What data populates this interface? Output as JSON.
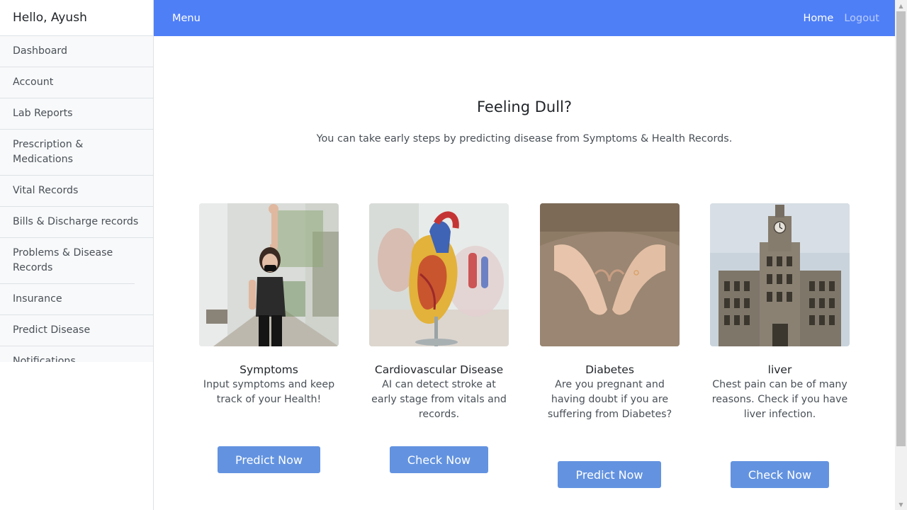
{
  "sidebar": {
    "greeting": "Hello, Ayush",
    "items": [
      {
        "label": "Dashboard"
      },
      {
        "label": "Account"
      },
      {
        "label": "Lab Reports"
      },
      {
        "label": "Prescription & Medications"
      },
      {
        "label": "Vital Records"
      },
      {
        "label": "Bills & Discharge records"
      },
      {
        "label": "Problems & Disease Records"
      },
      {
        "label": "Insurance"
      },
      {
        "label": "Predict Disease"
      },
      {
        "label": "Notifications"
      }
    ]
  },
  "navbar": {
    "menu_label": "Menu",
    "home_label": "Home",
    "logout_label": "Logout",
    "color": "#4f7ff7"
  },
  "hero": {
    "title": "Feeling Dull?",
    "subtitle": "You can take early steps by predicting disease from Symptoms & Health Records."
  },
  "cards": [
    {
      "title": "Symptoms",
      "text": "Input symptoms and keep track of your Health!",
      "button": "Predict Now",
      "image": "woman-raising-fist-photo"
    },
    {
      "title": "Cardiovascular Disease",
      "text": "AI can detect stroke at early stage from vitals and records.",
      "button": "Check Now",
      "image": "heart-model-photo"
    },
    {
      "title": "Diabetes",
      "text": "Are you pregnant and having doubt if you are suffering from Diabetes?",
      "button": "Predict Now",
      "image": "hands-heart-belly-photo"
    },
    {
      "title": "liver",
      "text": "Chest pain can be of many reasons. Check if you have liver infection.",
      "button": "Check Now",
      "image": "clock-tower-building-photo"
    }
  ],
  "colors": {
    "button": "#6393e0",
    "accent": "#4f7ff7"
  }
}
